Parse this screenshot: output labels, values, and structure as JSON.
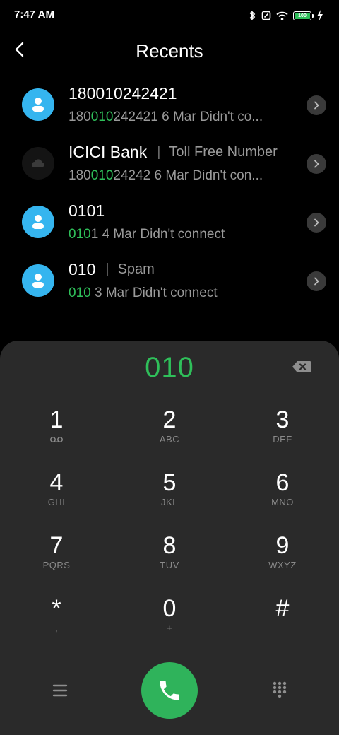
{
  "status_bar": {
    "time": "7:47 AM",
    "battery_level": "100",
    "icons": [
      "bluetooth-icon",
      "nfc-icon",
      "wifi-icon",
      "battery-icon",
      "charging-icon"
    ]
  },
  "header": {
    "title": "Recents",
    "back_icon": "back-arrow-icon"
  },
  "recents": [
    {
      "name": "180010242421",
      "tag": "",
      "number_pre": "180",
      "number_match": "010",
      "number_post": "242421",
      "date": "6 Mar",
      "status": "Didn't co...",
      "avatar": "contact-icon"
    },
    {
      "name": "ICICI Bank",
      "tag": "Toll Free Number",
      "number_pre": "180",
      "number_match": "010",
      "number_post": "24242",
      "date": "6 Mar",
      "status": "Didn't con...",
      "avatar": "cloud-icon"
    },
    {
      "name": "0101",
      "tag": "",
      "number_pre": "",
      "number_match": "010",
      "number_post": "1",
      "date": "4 Mar",
      "status": "Didn't connect",
      "avatar": "contact-icon"
    },
    {
      "name": "010",
      "tag": "Spam",
      "number_pre": "",
      "number_match": "010",
      "number_post": "",
      "date": "3 Mar",
      "status": "Didn't connect",
      "avatar": "contact-icon"
    }
  ],
  "dialer": {
    "display": "010",
    "keys": [
      {
        "digit": "1",
        "letters": ""
      },
      {
        "digit": "2",
        "letters": "ABC"
      },
      {
        "digit": "3",
        "letters": "DEF"
      },
      {
        "digit": "4",
        "letters": "GHI"
      },
      {
        "digit": "5",
        "letters": "JKL"
      },
      {
        "digit": "6",
        "letters": "MNO"
      },
      {
        "digit": "7",
        "letters": "PQRS"
      },
      {
        "digit": "8",
        "letters": "TUV"
      },
      {
        "digit": "9",
        "letters": "WXYZ"
      },
      {
        "digit": "*",
        "letters": ","
      },
      {
        "digit": "0",
        "letters": "+"
      },
      {
        "digit": "#",
        "letters": ""
      }
    ]
  },
  "colors": {
    "accent_green": "#2fbf5a",
    "avatar_blue": "#35b5ef",
    "dialer_bg": "#2a2a2a",
    "background": "#000000"
  }
}
